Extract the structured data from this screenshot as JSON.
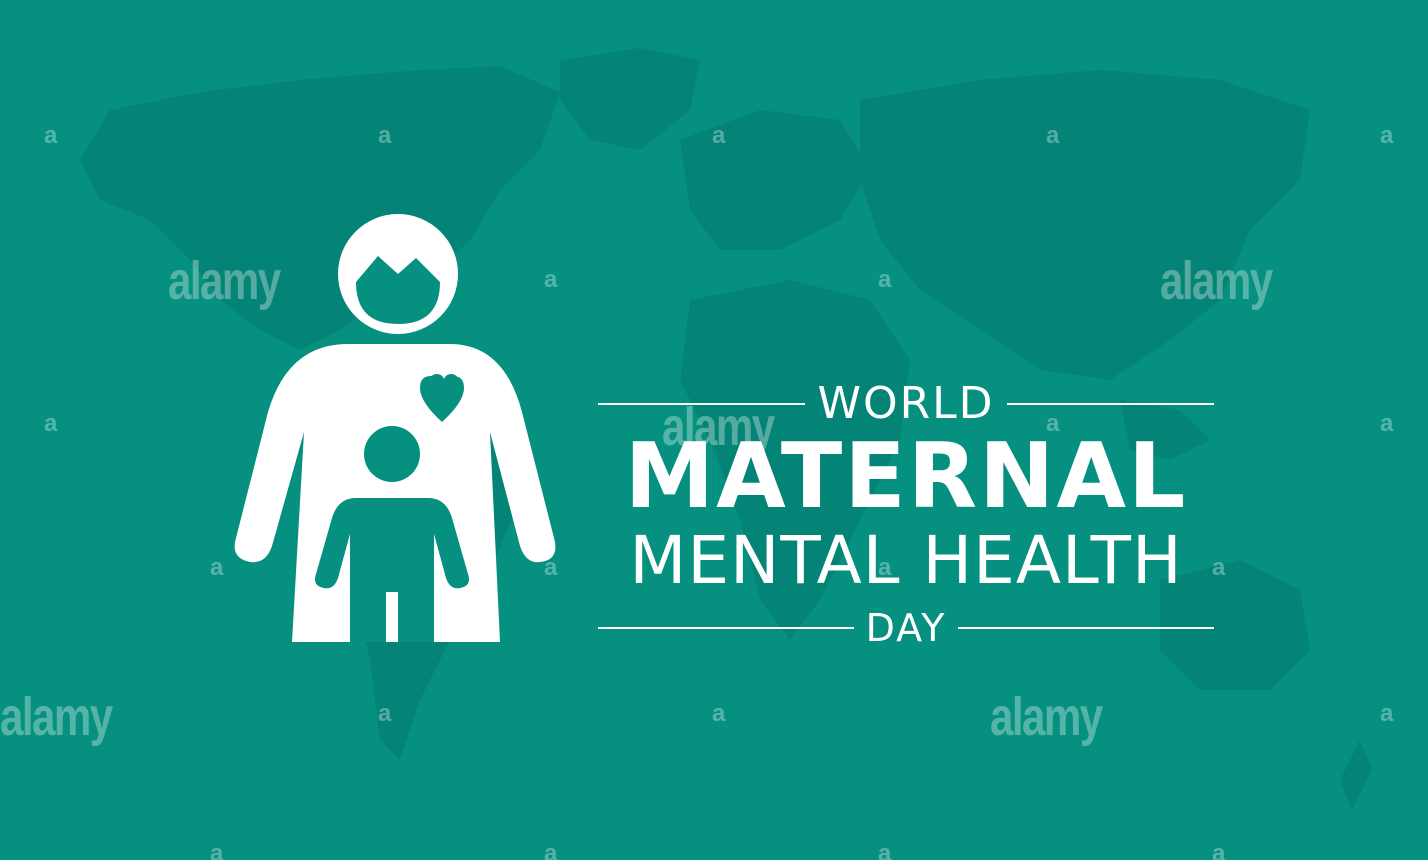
{
  "colors": {
    "background": "#05907f",
    "map": "#048476",
    "foreground": "#ffffff"
  },
  "title": {
    "line1": "WORLD",
    "line2": "MATERNAL",
    "line3": "MENTAL HEALTH",
    "line4": "DAY"
  },
  "icons": [
    "mother-icon",
    "child-icon",
    "heart-icon",
    "world-map-icon"
  ],
  "watermark": {
    "big": "alamy",
    "small": "a"
  }
}
